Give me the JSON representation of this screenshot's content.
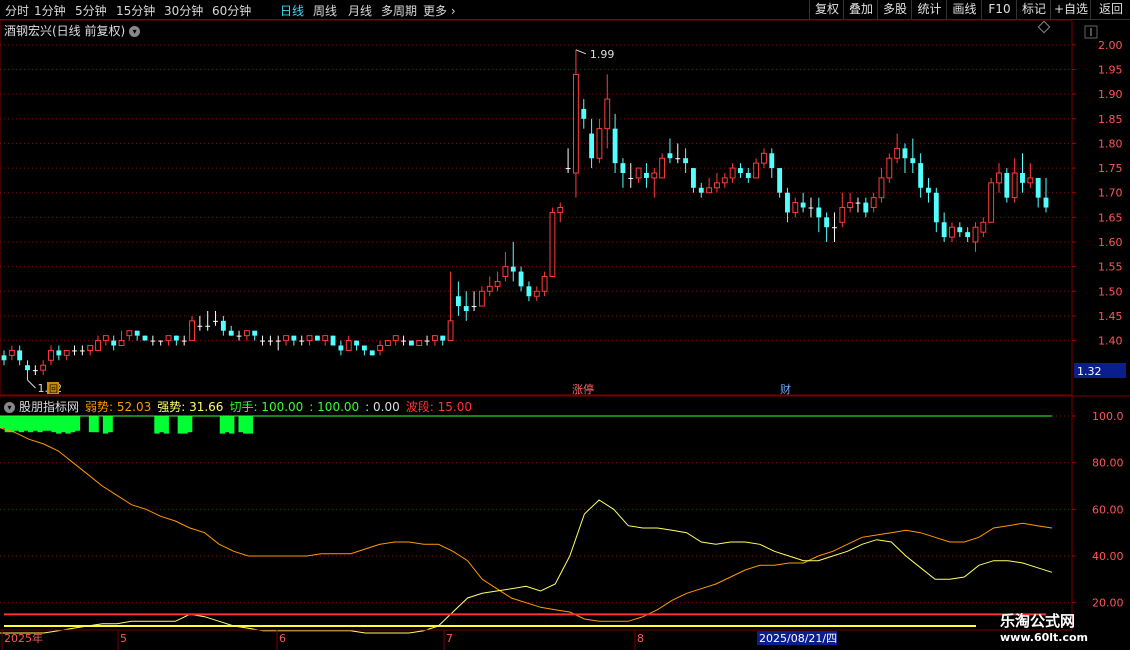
{
  "toolbar": {
    "timeframes": [
      "分时",
      "1分钟",
      "5分钟",
      "15分钟",
      "30分钟",
      "60分钟",
      "日线",
      "周线",
      "月线",
      "多周期",
      "更多"
    ],
    "active": "日线",
    "right_buttons": [
      "复权",
      "叠加",
      "多股",
      "统计",
      "画线",
      "F10",
      "标记",
      "+自选",
      "返回"
    ]
  },
  "title": {
    "stock": "酒钢宏兴(日线 前复权)"
  },
  "markers": {
    "badge_left": "回",
    "event1": "涨停",
    "event2": "财"
  },
  "price_labels": {
    "high": "1.99",
    "low": "1.32",
    "current": "1.32"
  },
  "indicator": {
    "name": "股朋指标网",
    "parts": [
      {
        "text": "弱势: 52.03",
        "color": "#ff9900"
      },
      {
        "text": "强势: 31.66",
        "color": "#ffff66"
      },
      {
        "text": "切手: 100.00",
        "color": "#33ff33"
      },
      {
        "text": ": 100.00",
        "color": "#33ff33"
      },
      {
        "text": ": 0.00",
        "color": "#dddddd"
      },
      {
        "text": "波段: 15.00",
        "color": "#ff3333"
      }
    ]
  },
  "date_axis": {
    "labels": [
      "2025年",
      "5",
      "6",
      "7",
      "8"
    ],
    "cursor_date": "2025/08/21/四"
  },
  "watermark": {
    "line1": "乐淘公式网",
    "line2": "www.60lt.com"
  },
  "chart_data": [
    {
      "type": "candlestick",
      "ylim": [
        1.32,
        2.02
      ],
      "yticks": [
        2.0,
        1.95,
        1.9,
        1.85,
        1.8,
        1.75,
        1.7,
        1.65,
        1.6,
        1.55,
        1.5,
        1.45,
        1.4
      ],
      "colors": {
        "up": "#ff3b3b",
        "down": "#54ffff",
        "flat": "#ffffff"
      },
      "candles": [
        [
          1.37,
          1.36,
          1.38,
          1.35
        ],
        [
          1.37,
          1.38,
          1.39,
          1.36
        ],
        [
          1.38,
          1.36,
          1.39,
          1.35
        ],
        [
          1.35,
          1.34,
          1.36,
          1.32
        ],
        [
          1.34,
          1.34,
          1.35,
          1.33
        ],
        [
          1.34,
          1.35,
          1.36,
          1.33
        ],
        [
          1.36,
          1.38,
          1.39,
          1.35
        ],
        [
          1.38,
          1.37,
          1.39,
          1.36
        ],
        [
          1.37,
          1.38,
          1.38,
          1.36
        ],
        [
          1.38,
          1.38,
          1.39,
          1.37
        ],
        [
          1.38,
          1.38,
          1.39,
          1.37
        ],
        [
          1.38,
          1.39,
          1.39,
          1.37
        ],
        [
          1.38,
          1.4,
          1.41,
          1.38
        ],
        [
          1.4,
          1.41,
          1.41,
          1.39
        ],
        [
          1.4,
          1.39,
          1.41,
          1.38
        ],
        [
          1.39,
          1.4,
          1.42,
          1.39
        ],
        [
          1.41,
          1.42,
          1.42,
          1.4
        ],
        [
          1.42,
          1.41,
          1.42,
          1.4
        ],
        [
          1.41,
          1.4,
          1.41,
          1.4
        ],
        [
          1.4,
          1.4,
          1.41,
          1.39
        ],
        [
          1.4,
          1.4,
          1.4,
          1.39
        ],
        [
          1.4,
          1.41,
          1.41,
          1.39
        ],
        [
          1.41,
          1.4,
          1.41,
          1.39
        ],
        [
          1.4,
          1.4,
          1.41,
          1.39
        ],
        [
          1.4,
          1.44,
          1.45,
          1.4
        ],
        [
          1.43,
          1.43,
          1.45,
          1.42
        ],
        [
          1.43,
          1.43,
          1.46,
          1.42
        ],
        [
          1.44,
          1.44,
          1.46,
          1.43
        ],
        [
          1.44,
          1.42,
          1.45,
          1.41
        ],
        [
          1.42,
          1.41,
          1.43,
          1.41
        ],
        [
          1.41,
          1.41,
          1.42,
          1.4
        ],
        [
          1.41,
          1.42,
          1.42,
          1.4
        ],
        [
          1.42,
          1.41,
          1.42,
          1.4
        ],
        [
          1.4,
          1.4,
          1.41,
          1.39
        ],
        [
          1.4,
          1.4,
          1.41,
          1.39
        ],
        [
          1.4,
          1.4,
          1.41,
          1.38
        ],
        [
          1.4,
          1.41,
          1.41,
          1.39
        ],
        [
          1.41,
          1.4,
          1.41,
          1.39
        ],
        [
          1.4,
          1.4,
          1.41,
          1.39
        ],
        [
          1.4,
          1.41,
          1.41,
          1.39
        ],
        [
          1.41,
          1.4,
          1.41,
          1.4
        ],
        [
          1.4,
          1.41,
          1.41,
          1.39
        ],
        [
          1.41,
          1.39,
          1.41,
          1.39
        ],
        [
          1.39,
          1.38,
          1.4,
          1.37
        ],
        [
          1.38,
          1.4,
          1.41,
          1.38
        ],
        [
          1.4,
          1.39,
          1.4,
          1.38
        ],
        [
          1.39,
          1.38,
          1.39,
          1.37
        ],
        [
          1.38,
          1.37,
          1.38,
          1.37
        ],
        [
          1.38,
          1.39,
          1.4,
          1.37
        ],
        [
          1.39,
          1.4,
          1.4,
          1.39
        ],
        [
          1.4,
          1.41,
          1.41,
          1.39
        ],
        [
          1.4,
          1.4,
          1.41,
          1.39
        ],
        [
          1.4,
          1.39,
          1.4,
          1.39
        ],
        [
          1.39,
          1.4,
          1.4,
          1.39
        ],
        [
          1.4,
          1.4,
          1.41,
          1.39
        ],
        [
          1.4,
          1.41,
          1.41,
          1.39
        ],
        [
          1.41,
          1.4,
          1.41,
          1.39
        ],
        [
          1.4,
          1.44,
          1.54,
          1.4
        ],
        [
          1.49,
          1.47,
          1.52,
          1.45
        ],
        [
          1.47,
          1.46,
          1.5,
          1.44
        ],
        [
          1.47,
          1.47,
          1.5,
          1.46
        ],
        [
          1.47,
          1.5,
          1.51,
          1.47
        ],
        [
          1.5,
          1.51,
          1.53,
          1.49
        ],
        [
          1.51,
          1.52,
          1.54,
          1.5
        ],
        [
          1.53,
          1.55,
          1.58,
          1.52
        ],
        [
          1.55,
          1.54,
          1.6,
          1.52
        ],
        [
          1.54,
          1.51,
          1.55,
          1.5
        ],
        [
          1.51,
          1.49,
          1.52,
          1.48
        ],
        [
          1.49,
          1.5,
          1.51,
          1.48
        ],
        [
          1.5,
          1.53,
          1.54,
          1.49
        ],
        [
          1.53,
          1.66,
          1.67,
          1.53
        ],
        [
          1.66,
          1.67,
          1.68,
          1.64
        ],
        [
          1.75,
          1.75,
          1.79,
          1.74
        ],
        [
          1.74,
          1.94,
          1.99,
          1.69
        ],
        [
          1.87,
          1.85,
          1.89,
          1.83
        ],
        [
          1.82,
          1.77,
          1.85,
          1.75
        ],
        [
          1.77,
          1.83,
          1.85,
          1.76
        ],
        [
          1.83,
          1.89,
          1.94,
          1.79
        ],
        [
          1.83,
          1.76,
          1.86,
          1.74
        ],
        [
          1.76,
          1.74,
          1.77,
          1.71
        ],
        [
          1.73,
          1.73,
          1.76,
          1.71
        ],
        [
          1.73,
          1.75,
          1.75,
          1.72
        ],
        [
          1.74,
          1.73,
          1.76,
          1.71
        ],
        [
          1.73,
          1.74,
          1.75,
          1.69
        ],
        [
          1.73,
          1.77,
          1.78,
          1.73
        ],
        [
          1.78,
          1.77,
          1.81,
          1.76
        ],
        [
          1.77,
          1.77,
          1.8,
          1.76
        ],
        [
          1.77,
          1.76,
          1.79,
          1.74
        ],
        [
          1.75,
          1.71,
          1.75,
          1.7
        ],
        [
          1.71,
          1.7,
          1.72,
          1.69
        ],
        [
          1.7,
          1.71,
          1.73,
          1.7
        ],
        [
          1.71,
          1.72,
          1.74,
          1.7
        ],
        [
          1.72,
          1.73,
          1.74,
          1.71
        ],
        [
          1.73,
          1.75,
          1.76,
          1.72
        ],
        [
          1.75,
          1.74,
          1.76,
          1.73
        ],
        [
          1.74,
          1.73,
          1.75,
          1.72
        ],
        [
          1.73,
          1.76,
          1.77,
          1.73
        ],
        [
          1.76,
          1.78,
          1.79,
          1.75
        ],
        [
          1.78,
          1.75,
          1.79,
          1.73
        ],
        [
          1.75,
          1.7,
          1.75,
          1.69
        ],
        [
          1.7,
          1.66,
          1.71,
          1.64
        ],
        [
          1.66,
          1.68,
          1.69,
          1.65
        ],
        [
          1.68,
          1.67,
          1.7,
          1.66
        ],
        [
          1.67,
          1.67,
          1.69,
          1.65
        ],
        [
          1.67,
          1.65,
          1.69,
          1.62
        ],
        [
          1.65,
          1.63,
          1.66,
          1.6
        ],
        [
          1.63,
          1.63,
          1.66,
          1.6
        ],
        [
          1.64,
          1.67,
          1.7,
          1.63
        ],
        [
          1.67,
          1.68,
          1.7,
          1.66
        ],
        [
          1.68,
          1.68,
          1.69,
          1.66
        ],
        [
          1.68,
          1.66,
          1.69,
          1.65
        ],
        [
          1.67,
          1.69,
          1.7,
          1.66
        ],
        [
          1.69,
          1.73,
          1.75,
          1.68
        ],
        [
          1.73,
          1.77,
          1.78,
          1.72
        ],
        [
          1.77,
          1.79,
          1.82,
          1.76
        ],
        [
          1.79,
          1.77,
          1.8,
          1.74
        ],
        [
          1.77,
          1.76,
          1.81,
          1.74
        ],
        [
          1.76,
          1.71,
          1.78,
          1.69
        ],
        [
          1.71,
          1.7,
          1.73,
          1.68
        ],
        [
          1.7,
          1.64,
          1.71,
          1.62
        ],
        [
          1.64,
          1.61,
          1.66,
          1.6
        ],
        [
          1.61,
          1.63,
          1.64,
          1.6
        ],
        [
          1.63,
          1.62,
          1.64,
          1.61
        ],
        [
          1.62,
          1.61,
          1.63,
          1.6
        ],
        [
          1.6,
          1.63,
          1.64,
          1.58
        ],
        [
          1.62,
          1.64,
          1.65,
          1.61
        ],
        [
          1.64,
          1.72,
          1.73,
          1.64
        ],
        [
          1.72,
          1.74,
          1.76,
          1.7
        ],
        [
          1.74,
          1.69,
          1.75,
          1.68
        ],
        [
          1.69,
          1.74,
          1.77,
          1.68
        ],
        [
          1.74,
          1.72,
          1.78,
          1.7
        ],
        [
          1.72,
          1.73,
          1.76,
          1.71
        ],
        [
          1.73,
          1.69,
          1.73,
          1.67
        ],
        [
          1.69,
          1.67,
          1.73,
          1.66
        ]
      ]
    },
    {
      "type": "line",
      "ylim": [
        0,
        110
      ],
      "yticks": [
        100.0,
        80.0,
        60.0,
        40.0,
        20.0
      ],
      "series": [
        {
          "name": "弱势",
          "color": "#ff9900",
          "values": [
            95,
            93,
            90,
            88,
            85,
            80,
            75,
            70,
            66,
            62,
            60,
            57,
            55,
            52,
            50,
            45,
            42,
            40,
            40,
            40,
            40,
            40,
            41,
            41,
            41,
            43,
            45,
            46,
            46,
            45,
            45,
            42,
            38,
            30,
            26,
            22,
            20,
            18,
            17,
            16,
            13,
            12,
            12,
            12,
            14,
            17,
            21,
            24,
            26,
            28,
            31,
            34,
            36,
            36,
            37,
            37,
            40,
            42,
            45,
            48,
            49,
            50,
            51,
            50,
            48,
            46,
            46,
            48,
            52,
            53,
            54,
            53,
            52
          ]
        },
        {
          "name": "强势",
          "color": "#ffff66",
          "values": [
            7,
            7,
            7,
            7,
            8,
            9,
            10,
            11,
            11,
            12,
            12,
            12,
            12,
            15,
            14,
            12,
            10,
            9,
            8,
            8,
            8,
            8,
            8,
            8,
            8,
            7,
            7,
            7,
            7,
            8,
            10,
            16,
            22,
            24,
            25,
            26,
            27,
            25,
            28,
            40,
            58,
            64,
            60,
            53,
            52,
            52,
            51,
            50,
            46,
            45,
            46,
            46,
            45,
            42,
            40,
            38,
            38,
            40,
            42,
            45,
            47,
            46,
            40,
            35,
            30,
            30,
            31,
            36,
            38,
            38,
            37,
            35,
            33
          ]
        },
        {
          "name": "切手",
          "color": "#33ff33",
          "values": [
            100,
            100,
            100,
            100,
            100,
            100,
            100,
            100,
            100,
            100,
            100,
            100,
            100,
            100,
            100,
            100,
            100,
            100,
            100,
            100,
            100,
            100,
            100,
            100,
            100,
            100,
            100,
            100,
            100,
            100,
            100,
            100,
            100,
            100,
            100,
            100,
            100,
            100,
            100,
            100,
            100,
            100,
            100,
            100,
            100,
            100,
            100,
            100,
            100,
            100,
            100,
            100,
            100,
            100,
            100,
            100,
            100,
            100,
            100,
            100,
            100,
            100,
            100,
            100,
            100,
            100,
            100,
            100,
            100,
            100,
            100,
            100,
            100
          ]
        },
        {
          "name": "波段",
          "color": "#ff3333",
          "values": [
            15,
            15,
            15,
            15,
            15,
            15,
            15,
            15,
            15,
            15,
            15,
            15,
            15,
            15,
            15,
            15,
            15,
            15,
            15,
            15,
            15,
            15,
            15,
            15,
            15,
            15,
            15,
            15,
            15,
            15,
            15,
            15,
            15,
            15,
            15,
            15,
            15,
            15,
            15,
            15,
            15,
            15,
            15,
            15,
            15,
            15,
            15,
            15,
            15,
            15,
            15,
            15,
            15,
            15,
            15,
            15,
            15,
            15,
            15,
            15,
            15,
            15,
            15,
            15,
            15,
            15,
            15,
            15,
            15,
            15,
            15,
            15,
            15
          ]
        }
      ],
      "bars": {
        "color": "#00ff33",
        "values": [
          100,
          97,
          97,
          98,
          97,
          98,
          97,
          98,
          97,
          98,
          98,
          97,
          96,
          97,
          96,
          97,
          98,
          97,
          96,
          97,
          97,
          96,
          96,
          97,
          96,
          98,
          97,
          97,
          96,
          96,
          97,
          96,
          96,
          96,
          97,
          96,
          97,
          96,
          96,
          96,
          97,
          96,
          96,
          96,
          97,
          96,
          96,
          96,
          97,
          96,
          96,
          97,
          96,
          96,
          96,
          96,
          96,
          97,
          96,
          96,
          96,
          96,
          96,
          96,
          96,
          96,
          96,
          96,
          96,
          96,
          96,
          96,
          96
        ]
      }
    }
  ]
}
